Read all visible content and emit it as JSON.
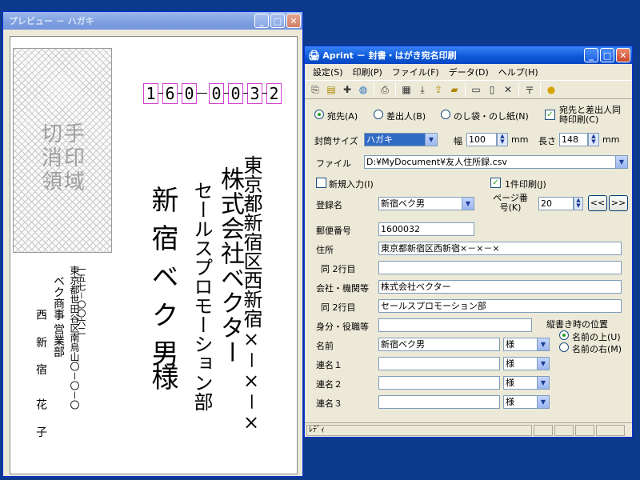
{
  "preview": {
    "title": "プレビュー － ハガキ",
    "stamp_text": "切手消印領域",
    "zip_digits": [
      "1",
      "6",
      "0",
      "0",
      "0",
      "3",
      "2"
    ],
    "recipient_address": "東京都新宿区西新宿×－×－×",
    "recipient_company": "株式会社ベクター",
    "recipient_dept": "セールスプロモーション部",
    "recipient_name": "新宿ベク男",
    "recipient_honorific": "様",
    "sender_zip": "一五七－〇〇六二",
    "sender_address": "東京都世田谷区南烏山〇－〇－〇",
    "sender_company": "ベク商事 営業部",
    "sender_name_given": "西 新 宿",
    "sender_name_family": "花 子"
  },
  "main": {
    "title": "Aprint － 封書・はがき宛名印刷",
    "menu": [
      "設定(S)",
      "印刷(P)",
      "ファイル(F)",
      "データ(D)",
      "ヘルプ(H)"
    ],
    "toolbar_icons": [
      "preview-icon",
      "list-icon",
      "add-icon",
      "globe-icon",
      "print-icon",
      "table-icon",
      "import-icon",
      "export-icon",
      "open-icon",
      "copy-icon",
      "paste-icon",
      "delete-icon",
      "vertical-icon",
      "bulb-icon"
    ],
    "radio_to": "宛先(A)",
    "radio_from": "差出人(B)",
    "radio_noshi": "のし袋・のし紙(N)",
    "check_both": "宛先と差出人同時印刷(C)",
    "envelope_size_label": "封筒サイズ",
    "envelope_size_value": "ハガキ",
    "width_label": "幅",
    "width_value": "100",
    "width_unit": "mm",
    "height_label": "長さ",
    "height_value": "148",
    "height_unit": "mm",
    "file_label": "ファイル",
    "file_value": "D:¥MyDocument¥友人住所録.csv",
    "check_new_entry": "新規入力(I)",
    "check_single_print": "1件印刷(J)",
    "reg_name_label": "登録名",
    "reg_name_value": "新宿ベク男",
    "page_no_label": "ページ番号(K)",
    "page_no_value": "20",
    "prev_btn": "<<",
    "next_btn": ">>",
    "postal_label": "郵便番号",
    "postal_value": "1600032",
    "address_label": "住所",
    "address_value": "東京都新宿区西新宿×－×－×",
    "address2_label": "同 2行目",
    "address2_value": "",
    "company_label": "会社・機関等",
    "company_value": "株式会社ベクター",
    "company2_label": "同 2行目",
    "company2_value": "セールスプロモーション部",
    "title_label": "身分・役職等",
    "title_value": "",
    "vertical_pos_label": "縦書き時の位置",
    "radio_above": "名前の上(U)",
    "radio_right": "名前の右(M)",
    "name_label": "名前",
    "name_value": "新宿ベク男",
    "honorific": "様",
    "joint1_label": "連名１",
    "joint2_label": "連名２",
    "joint3_label": "連名３",
    "joint_honorific": "様",
    "status": "ﾚﾃﾞｨ"
  }
}
